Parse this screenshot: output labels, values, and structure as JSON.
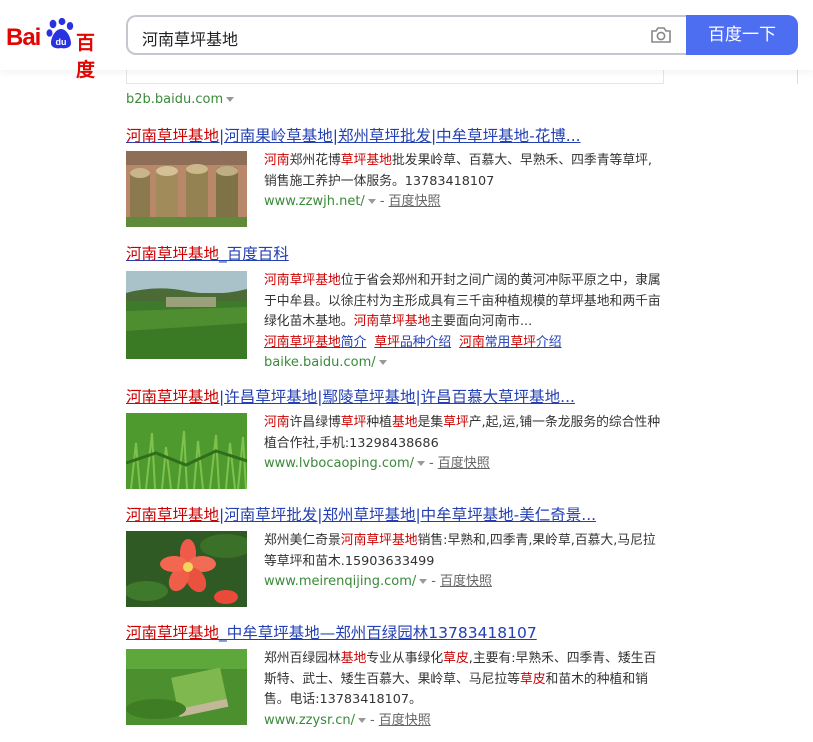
{
  "header": {
    "logo_latin": "Bai",
    "logo_cn": "百度",
    "search_value": "河南草坪基地",
    "search_button": "百度一下"
  },
  "top_site": "b2b.baidu.com",
  "results": [
    {
      "title_parts": [
        {
          "t": "河南草坪基地",
          "hl": true
        },
        {
          "t": "|河南果岭草基地|郑州草坪批发|中牟草坪基地-花博...",
          "hl": false
        }
      ],
      "snippet_parts": [
        {
          "t": "河南",
          "hl": true
        },
        {
          "t": "郑州花博",
          "hl": false
        },
        {
          "t": "草坪基地",
          "hl": true
        },
        {
          "t": "批发果岭草、百慕大、早熟禾、四季青等草坪,销售施工养护一体服务。13783418107",
          "hl": false
        }
      ],
      "url": "www.zzwjh.net/",
      "snapshot": "百度快照"
    },
    {
      "title_parts": [
        {
          "t": "河南草坪基地",
          "hl": true
        },
        {
          "t": "_百度百科",
          "hl": false
        }
      ],
      "snippet_parts": [
        {
          "t": "河南草坪基地",
          "hl": true
        },
        {
          "t": "位于省会郑州和开封之间广阔的黄河冲际平原之中，隶属于中牟县。以徐庄村为主形成具有三千亩种植规模的草坪基地和两千亩绿化苗木基地。",
          "hl": false
        },
        {
          "t": "河南草坪基地",
          "hl": true
        },
        {
          "t": "主要面向河南市...",
          "hl": false
        }
      ],
      "sublinks": [
        [
          {
            "t": "河南草坪基地",
            "hl": true
          },
          {
            "t": "简介",
            "hl": false
          }
        ],
        [
          {
            "t": "草坪",
            "hl": true
          },
          {
            "t": "品种介绍",
            "hl": false
          }
        ],
        [
          {
            "t": "河南",
            "hl": true
          },
          {
            "t": "常用",
            "hl": false
          },
          {
            "t": "草坪",
            "hl": true
          },
          {
            "t": "介绍",
            "hl": false
          }
        ]
      ],
      "url": "baike.baidu.com/",
      "snapshot": ""
    },
    {
      "title_parts": [
        {
          "t": "河南草坪基地",
          "hl": true
        },
        {
          "t": "|许昌草坪基地|鄢陵草坪基地|许昌百慕大草坪基地...",
          "hl": false
        }
      ],
      "snippet_parts": [
        {
          "t": "河南",
          "hl": true
        },
        {
          "t": "许昌绿博",
          "hl": false
        },
        {
          "t": "草坪",
          "hl": true
        },
        {
          "t": "种植",
          "hl": false
        },
        {
          "t": "基地",
          "hl": true
        },
        {
          "t": "是集",
          "hl": false
        },
        {
          "t": "草坪",
          "hl": true
        },
        {
          "t": "产,起,运,铺一条龙服务的综合性种植合作社,手机:13298438686",
          "hl": false
        }
      ],
      "url": "www.lvbocaoping.com/",
      "snapshot": "百度快照"
    },
    {
      "title_parts": [
        {
          "t": "河南草坪基地",
          "hl": true
        },
        {
          "t": "|河南草坪批发|郑州草坪基地|中牟草坪基地-美仁奇景...",
          "hl": false
        }
      ],
      "snippet_parts": [
        {
          "t": "郑州美仁奇景",
          "hl": false
        },
        {
          "t": "河南草坪基地",
          "hl": true
        },
        {
          "t": "销售:早熟和,四季青,果岭草,百慕大,马尼拉等草坪和苗木.15903633499",
          "hl": false
        }
      ],
      "url": "www.meirenqijing.com/",
      "snapshot": "百度快照"
    },
    {
      "title_parts": [
        {
          "t": "河南草坪基地",
          "hl": true
        },
        {
          "t": "_中牟草坪基地—郑州百绿园林13783418107",
          "hl": false
        }
      ],
      "snippet_parts": [
        {
          "t": "郑州百绿园林",
          "hl": false
        },
        {
          "t": "基地",
          "hl": true
        },
        {
          "t": "专业从事绿化",
          "hl": false
        },
        {
          "t": "草皮",
          "hl": true
        },
        {
          "t": ",主要有:早熟禾、四季青、矮生百斯特、武士、矮生百慕大、果岭草、马尼拉等",
          "hl": false
        },
        {
          "t": "草皮",
          "hl": true
        },
        {
          "t": "和苗木的种植和销售。电话:13783418107。",
          "hl": false
        }
      ],
      "url": "www.zzysr.cn/",
      "snapshot": "百度快照"
    }
  ],
  "colors": {
    "link": "#2440b3",
    "highlight": "#c00000",
    "url_green": "#3a8a3a",
    "button_blue": "#4e6ef2",
    "logo_red": "#e10601"
  }
}
